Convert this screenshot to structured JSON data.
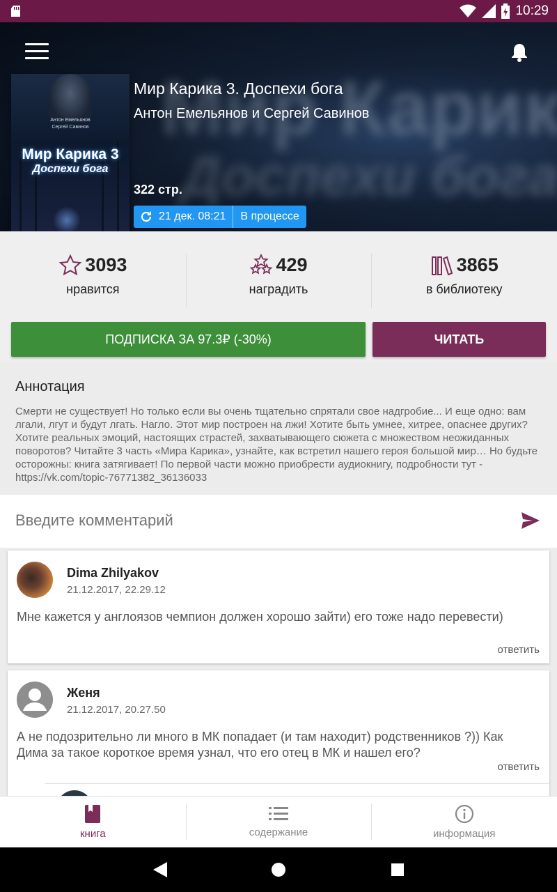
{
  "status_bar": {
    "time": "10:29"
  },
  "colors": {
    "accent": "#7b2d59",
    "subscribe": "#3d8f3a",
    "status_pill": "#2196f3",
    "status_bar": "#6b1a47"
  },
  "book": {
    "title": "Мир Карика 3. Доспехи бога",
    "author": "Антон Емельянов и Сергей Савинов",
    "pages": "322 стр.",
    "updated": "21 дек. 08:21",
    "state": "В процессе",
    "cover": {
      "authors_line1": "Антон Емельянов",
      "authors_line2": "Сергей Савинов",
      "title": "Мир Карика 3",
      "subtitle": "Доспехи бога"
    }
  },
  "stats": [
    {
      "icon": "star-outline-icon",
      "value": "3093",
      "label": "нравится"
    },
    {
      "icon": "award-stars-icon",
      "value": "429",
      "label": "наградить"
    },
    {
      "icon": "library-icon",
      "value": "3865",
      "label": "в библиотеку"
    }
  ],
  "actions": {
    "subscribe": "ПОДПИСКА ЗА 97.3₽ (-30%)",
    "read": "ЧИТАТЬ"
  },
  "annotation": {
    "heading": "Аннотация",
    "text": "Смерти не существует! Но только если вы очень тщательно спрятали свое надгробие... И еще одно: вам лгали, лгут и будут лгать. Нагло. Этот мир построен на лжи! Хотите быть умнее, хитрее, опаснее других? Хотите реальных эмоций, настоящих страстей, захватывающего сюжета с множеством неожиданных поворотов? Читайте 3 часть «Мира Карика», узнайте, как встретил нашего героя большой мир… Но будьте осторожны: книга затягивает! По первой части можно приобрести аудиокнигу, подробности тут - https://vk.com/topic-76771382_36136033"
  },
  "comment_input": {
    "placeholder": "Введите комментарий"
  },
  "comments": [
    {
      "name": "Dima Zhilyakov",
      "time": "21.12.2017, 22.29.12",
      "text": "Мне кажется у англоязов чемпион должен хорошо зайти) его тоже надо перевести)",
      "reply": "ответить"
    },
    {
      "name": "Женя",
      "time": "21.12.2017, 20.27.50",
      "text": "А не подозрительно ли много в МК попадает (и там находит) родственников ?)) Как Дима за такое короткое время узнал, что его отец в МК и нашел его?",
      "reply": "ответить"
    }
  ],
  "bottom_nav": [
    {
      "icon": "book-icon",
      "label": "книга",
      "active": true
    },
    {
      "icon": "list-icon",
      "label": "содержание",
      "active": false
    },
    {
      "icon": "info-icon",
      "label": "информация",
      "active": false
    }
  ]
}
